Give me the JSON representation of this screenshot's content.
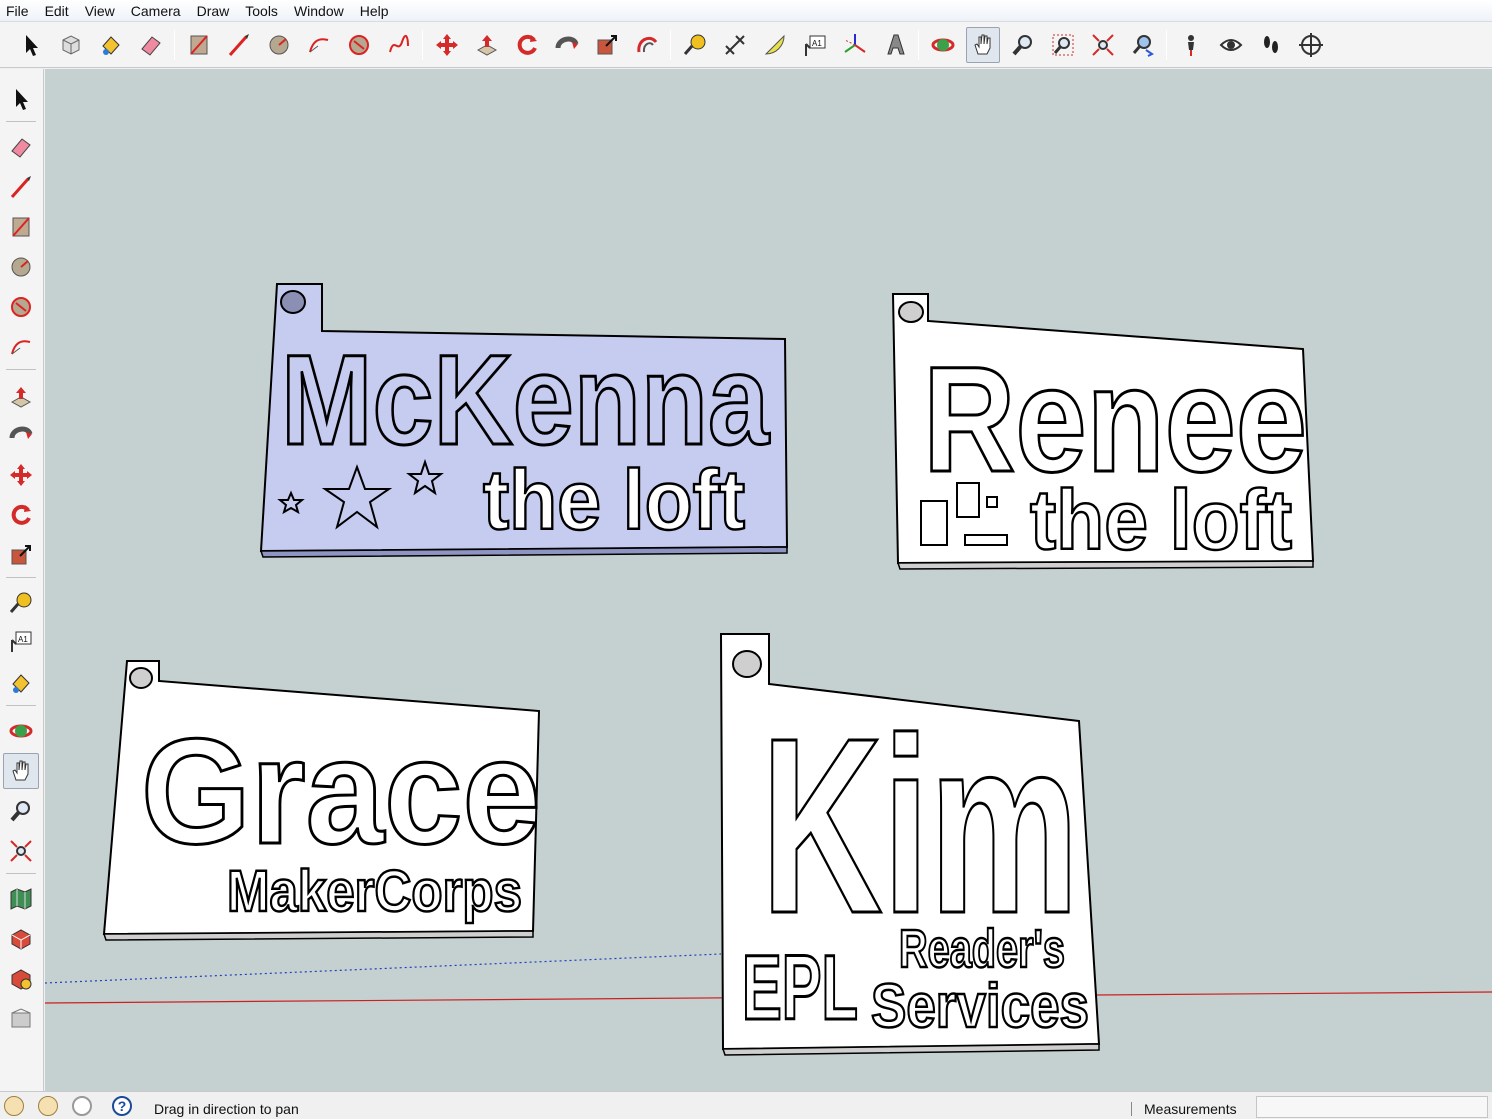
{
  "menubar": {
    "items": [
      "File",
      "Edit",
      "View",
      "Camera",
      "Draw",
      "Tools",
      "Window",
      "Help"
    ]
  },
  "toolbar": {
    "buttons": [
      {
        "icon": "select-icon"
      },
      {
        "icon": "make-component-icon"
      },
      {
        "icon": "paint-bucket-icon"
      },
      {
        "icon": "eraser-icon"
      },
      {
        "icon": "rectangle-icon"
      },
      {
        "icon": "line-icon"
      },
      {
        "icon": "circle-icon"
      },
      {
        "icon": "arc-icon"
      },
      {
        "icon": "polygon-icon"
      },
      {
        "icon": "freehand-icon"
      },
      {
        "icon": "move-icon"
      },
      {
        "icon": "push-pull-icon"
      },
      {
        "icon": "rotate-icon"
      },
      {
        "icon": "follow-me-icon"
      },
      {
        "icon": "scale-icon"
      },
      {
        "icon": "offset-icon"
      },
      {
        "icon": "tape-measure-icon"
      },
      {
        "icon": "dimension-icon"
      },
      {
        "icon": "protractor-icon"
      },
      {
        "icon": "text-icon"
      },
      {
        "icon": "axes-icon"
      },
      {
        "icon": "3d-text-icon"
      },
      {
        "icon": "orbit-icon"
      },
      {
        "icon": "pan-icon"
      },
      {
        "icon": "zoom-icon"
      },
      {
        "icon": "zoom-window-icon"
      },
      {
        "icon": "zoom-extents-icon"
      },
      {
        "icon": "previous-view-icon"
      },
      {
        "icon": "position-camera-icon"
      },
      {
        "icon": "look-around-icon"
      },
      {
        "icon": "walk-icon"
      },
      {
        "icon": "section-plane-icon"
      }
    ],
    "text_tool_label": "A1"
  },
  "lefttoolbar": {
    "text_tool_label": "A1"
  },
  "scene": {
    "tags": [
      {
        "name": "McKenna",
        "subtitle": "the loft",
        "color": "#c6cbf0"
      },
      {
        "name": "Renee",
        "subtitle": "the loft",
        "color": "#ffffff"
      },
      {
        "name": "Grace",
        "subtitle": "MakerCorps",
        "color": "#ffffff"
      },
      {
        "name": "Kim",
        "line2a": "EPL",
        "line2b": "Reader's",
        "line2c": "Services",
        "color": "#ffffff"
      }
    ],
    "background_color": "#c5d0d0",
    "axis_red_color": "#cc2020",
    "axis_blue_color": "#2040c0"
  },
  "statusbar": {
    "hint": "Drag in direction to pan",
    "measurements_label": "Measurements",
    "measurements_value": ""
  }
}
